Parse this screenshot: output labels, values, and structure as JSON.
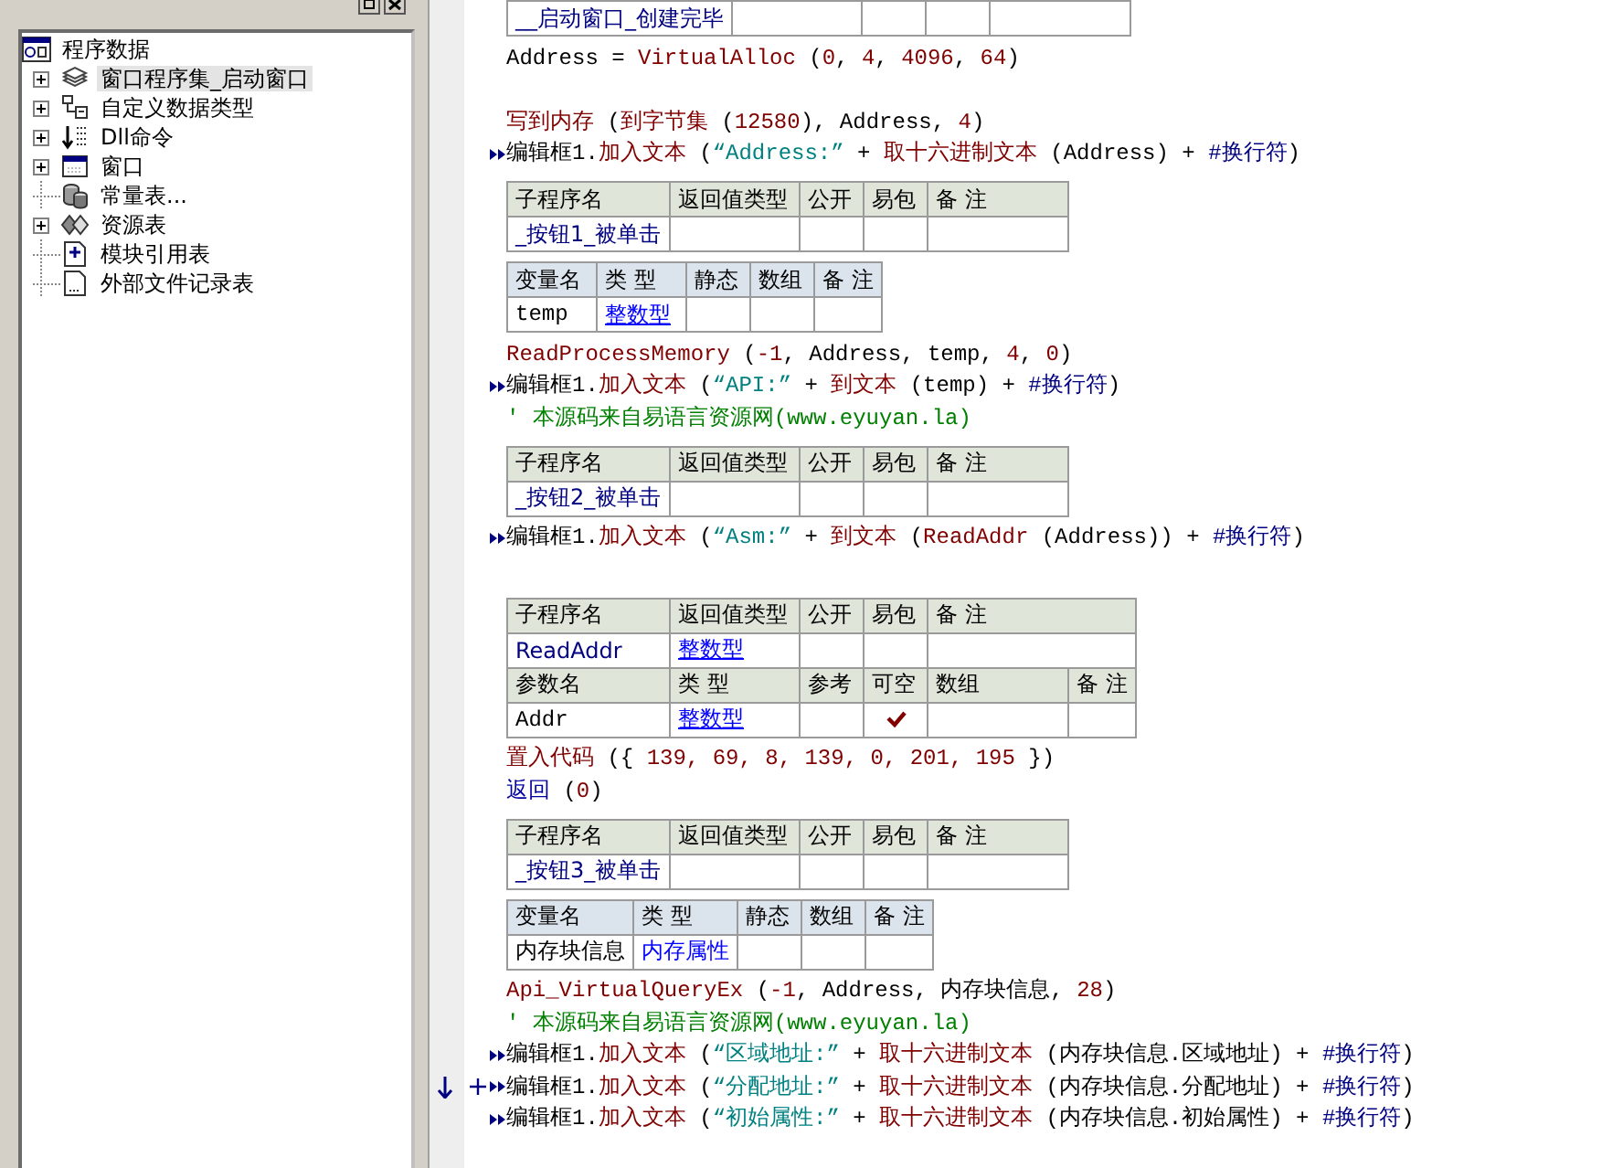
{
  "tree": {
    "root": {
      "label": "程序数据"
    },
    "items": [
      {
        "label": "窗口程序集_启动窗口",
        "kind": "pages",
        "expandable": true,
        "selected": true
      },
      {
        "label": "自定义数据类型",
        "kind": "types",
        "expandable": true,
        "selected": false
      },
      {
        "label": "Dll命令",
        "kind": "dll",
        "expandable": true,
        "selected": false
      },
      {
        "label": "窗口",
        "kind": "window",
        "expandable": true,
        "selected": false
      },
      {
        "label": "常量表...",
        "kind": "constants",
        "expandable": false,
        "selected": false
      },
      {
        "label": "资源表",
        "kind": "resources",
        "expandable": true,
        "selected": false
      },
      {
        "label": "模块引用表",
        "kind": "module",
        "expandable": false,
        "selected": false
      },
      {
        "label": "外部文件记录表",
        "kind": "file",
        "expandable": false,
        "selected": false
      }
    ]
  },
  "code": [
    {
      "kind": "sub_table",
      "rows": [
        {
          "header": false,
          "cells": [
            {
              "text": "__启动窗口_创建完毕",
              "kind": "name"
            },
            {},
            {},
            {},
            {}
          ]
        }
      ]
    },
    {
      "kind": "line",
      "arrow": false,
      "plus": false,
      "down": false,
      "tokens": [
        {
          "text": "Address = ",
          "kind": "plain"
        },
        {
          "text": "VirtualAlloc",
          "kind": "func"
        },
        {
          "text": " (",
          "kind": "plain"
        },
        {
          "text": "0",
          "kind": "num"
        },
        {
          "text": ", ",
          "kind": "plain"
        },
        {
          "text": "4",
          "kind": "num"
        },
        {
          "text": ", ",
          "kind": "plain"
        },
        {
          "text": "4096",
          "kind": "num"
        },
        {
          "text": ", ",
          "kind": "plain"
        },
        {
          "text": "64",
          "kind": "num"
        },
        {
          "text": ")",
          "kind": "plain"
        }
      ]
    },
    {
      "kind": "blank"
    },
    {
      "kind": "line",
      "arrow": false,
      "plus": false,
      "down": false,
      "tokens": [
        {
          "text": "写到内存",
          "kind": "func"
        },
        {
          "text": " (",
          "kind": "plain"
        },
        {
          "text": "到字节集",
          "kind": "func"
        },
        {
          "text": " (",
          "kind": "plain"
        },
        {
          "text": "12580",
          "kind": "num"
        },
        {
          "text": "), Address, ",
          "kind": "plain"
        },
        {
          "text": "4",
          "kind": "num"
        },
        {
          "text": ")",
          "kind": "plain"
        }
      ]
    },
    {
      "kind": "line",
      "arrow": true,
      "plus": false,
      "down": false,
      "tokens": [
        {
          "text": "编辑框1.",
          "kind": "plain"
        },
        {
          "text": "加入文本",
          "kind": "func"
        },
        {
          "text": " (",
          "kind": "plain"
        },
        {
          "text": "“Address:”",
          "kind": "str"
        },
        {
          "text": " + ",
          "kind": "plain"
        },
        {
          "text": "取十六进制文本",
          "kind": "func"
        },
        {
          "text": " (Address) + ",
          "kind": "plain"
        },
        {
          "text": "#换行符",
          "kind": "const"
        },
        {
          "text": ")",
          "kind": "plain"
        }
      ]
    },
    {
      "kind": "sub_table",
      "rows": [
        {
          "header": true,
          "cells": [
            {
              "text": "子程序名"
            },
            {
              "text": "返回值类型"
            },
            {
              "text": "公开"
            },
            {
              "text": "易包"
            },
            {
              "text": "备 注"
            }
          ]
        },
        {
          "header": false,
          "cells": [
            {
              "text": "_按钮1_被单击",
              "kind": "name"
            },
            {},
            {},
            {},
            {}
          ]
        }
      ]
    },
    {
      "kind": "var_table",
      "rows": [
        {
          "header": true,
          "cells": [
            {
              "text": "变量名"
            },
            {
              "text": "类 型"
            },
            {
              "text": "静态"
            },
            {
              "text": "数组"
            },
            {
              "text": "备 注"
            }
          ]
        },
        {
          "header": false,
          "cells": [
            {
              "text": "temp",
              "kind": "plain"
            },
            {
              "text": "整数型",
              "kind": "link"
            },
            {},
            {},
            {}
          ]
        }
      ]
    },
    {
      "kind": "line",
      "arrow": false,
      "plus": false,
      "down": false,
      "tokens": [
        {
          "text": "ReadProcessMemory",
          "kind": "func"
        },
        {
          "text": " (",
          "kind": "plain"
        },
        {
          "text": "-1",
          "kind": "num"
        },
        {
          "text": ", Address, temp, ",
          "kind": "plain"
        },
        {
          "text": "4",
          "kind": "num"
        },
        {
          "text": ", ",
          "kind": "plain"
        },
        {
          "text": "0",
          "kind": "num"
        },
        {
          "text": ")",
          "kind": "plain"
        }
      ]
    },
    {
      "kind": "line",
      "arrow": true,
      "plus": false,
      "down": false,
      "tokens": [
        {
          "text": "编辑框1.",
          "kind": "plain"
        },
        {
          "text": "加入文本",
          "kind": "func"
        },
        {
          "text": " (",
          "kind": "plain"
        },
        {
          "text": "“API:”",
          "kind": "str"
        },
        {
          "text": " + ",
          "kind": "plain"
        },
        {
          "text": "到文本",
          "kind": "func"
        },
        {
          "text": " (temp) + ",
          "kind": "plain"
        },
        {
          "text": "#换行符",
          "kind": "const"
        },
        {
          "text": ")",
          "kind": "plain"
        }
      ]
    },
    {
      "kind": "line",
      "arrow": false,
      "plus": false,
      "down": false,
      "tokens": [
        {
          "text": "' 本源码来自易语言资源网(www.eyuyan.la)",
          "kind": "comment"
        }
      ]
    },
    {
      "kind": "sub_table",
      "rows": [
        {
          "header": true,
          "cells": [
            {
              "text": "子程序名"
            },
            {
              "text": "返回值类型"
            },
            {
              "text": "公开"
            },
            {
              "text": "易包"
            },
            {
              "text": "备 注"
            }
          ]
        },
        {
          "header": false,
          "cells": [
            {
              "text": "_按钮2_被单击",
              "kind": "name"
            },
            {},
            {},
            {},
            {}
          ]
        }
      ]
    },
    {
      "kind": "line",
      "arrow": true,
      "plus": false,
      "down": false,
      "tokens": [
        {
          "text": "编辑框1.",
          "kind": "plain"
        },
        {
          "text": "加入文本",
          "kind": "func"
        },
        {
          "text": " (",
          "kind": "plain"
        },
        {
          "text": "“Asm:”",
          "kind": "str"
        },
        {
          "text": " + ",
          "kind": "plain"
        },
        {
          "text": "到文本",
          "kind": "func"
        },
        {
          "text": " (",
          "kind": "plain"
        },
        {
          "text": "ReadAddr",
          "kind": "func"
        },
        {
          "text": " (Address)) + ",
          "kind": "plain"
        },
        {
          "text": "#换行符",
          "kind": "const"
        },
        {
          "text": ")",
          "kind": "plain"
        }
      ]
    },
    {
      "kind": "blank"
    },
    {
      "kind": "sub_table",
      "rows": [
        {
          "header": true,
          "cells": [
            {
              "text": "子程序名"
            },
            {
              "text": "返回值类型"
            },
            {
              "text": "公开"
            },
            {
              "text": "易包"
            },
            {
              "text": "备 注",
              "colspan": 2
            }
          ]
        },
        {
          "header": false,
          "cells": [
            {
              "text": "ReadAddr",
              "kind": "name"
            },
            {
              "text": "整数型",
              "kind": "link"
            },
            {},
            {},
            {
              "colspan": 2
            }
          ]
        },
        {
          "header": true,
          "cells": [
            {
              "text": "参数名"
            },
            {
              "text": "类 型"
            },
            {
              "text": "参考"
            },
            {
              "text": "可空"
            },
            {
              "text": "数组"
            },
            {
              "text": "备 注"
            }
          ]
        },
        {
          "header": false,
          "cells": [
            {
              "text": "Addr",
              "kind": "plain"
            },
            {
              "text": "整数型",
              "kind": "link"
            },
            {},
            {
              "check": true
            },
            {},
            {}
          ]
        }
      ]
    },
    {
      "kind": "line",
      "arrow": false,
      "plus": false,
      "down": false,
      "tokens": [
        {
          "text": "置入代码",
          "kind": "func"
        },
        {
          "text": " ({ ",
          "kind": "plain"
        },
        {
          "text": "139, 69, 8, 139, 0, 201, 195",
          "kind": "num"
        },
        {
          "text": " })",
          "kind": "plain"
        }
      ]
    },
    {
      "kind": "line",
      "arrow": false,
      "plus": false,
      "down": false,
      "tokens": [
        {
          "text": "返回",
          "kind": "keyword"
        },
        {
          "text": " (",
          "kind": "plain"
        },
        {
          "text": "0",
          "kind": "num"
        },
        {
          "text": ")",
          "kind": "plain"
        }
      ]
    },
    {
      "kind": "sub_table",
      "rows": [
        {
          "header": true,
          "cells": [
            {
              "text": "子程序名"
            },
            {
              "text": "返回值类型"
            },
            {
              "text": "公开"
            },
            {
              "text": "易包"
            },
            {
              "text": "备 注"
            }
          ]
        },
        {
          "header": false,
          "cells": [
            {
              "text": "_按钮3_被单击",
              "kind": "name"
            },
            {},
            {},
            {},
            {}
          ]
        }
      ]
    },
    {
      "kind": "var_table",
      "rows": [
        {
          "header": true,
          "cells": [
            {
              "text": "变量名"
            },
            {
              "text": "类 型"
            },
            {
              "text": "静态"
            },
            {
              "text": "数组"
            },
            {
              "text": "备 注"
            }
          ]
        },
        {
          "header": false,
          "cells": [
            {
              "text": "内存块信息",
              "kind": "plain"
            },
            {
              "text": "内存属性",
              "kind": "type"
            },
            {},
            {},
            {}
          ]
        }
      ]
    },
    {
      "kind": "line",
      "arrow": false,
      "plus": false,
      "down": false,
      "tokens": [
        {
          "text": "Api_VirtualQueryEx",
          "kind": "func"
        },
        {
          "text": " (",
          "kind": "plain"
        },
        {
          "text": "-1",
          "kind": "num"
        },
        {
          "text": ", Address, 内存块信息, ",
          "kind": "plain"
        },
        {
          "text": "28",
          "kind": "num"
        },
        {
          "text": ")",
          "kind": "plain"
        }
      ]
    },
    {
      "kind": "line",
      "arrow": false,
      "plus": false,
      "down": false,
      "tokens": [
        {
          "text": "' 本源码来自易语言资源网(www.eyuyan.la)",
          "kind": "comment"
        }
      ]
    },
    {
      "kind": "line",
      "arrow": true,
      "plus": false,
      "down": false,
      "tokens": [
        {
          "text": "编辑框1.",
          "kind": "plain"
        },
        {
          "text": "加入文本",
          "kind": "func"
        },
        {
          "text": " (",
          "kind": "plain"
        },
        {
          "text": "“区域地址:”",
          "kind": "str"
        },
        {
          "text": " + ",
          "kind": "plain"
        },
        {
          "text": "取十六进制文本",
          "kind": "func"
        },
        {
          "text": " (内存块信息.区域地址) + ",
          "kind": "plain"
        },
        {
          "text": "#换行符",
          "kind": "const"
        },
        {
          "text": ")",
          "kind": "plain"
        }
      ]
    },
    {
      "kind": "line",
      "arrow": true,
      "plus": true,
      "down": true,
      "tokens": [
        {
          "text": "编辑框1.",
          "kind": "plain"
        },
        {
          "text": "加入文本",
          "kind": "func"
        },
        {
          "text": " (",
          "kind": "plain"
        },
        {
          "text": "“分配地址:”",
          "kind": "str"
        },
        {
          "text": " + ",
          "kind": "plain"
        },
        {
          "text": "取十六进制文本",
          "kind": "func"
        },
        {
          "text": " (内存块信息.分配地址) + ",
          "kind": "plain"
        },
        {
          "text": "#换行符",
          "kind": "const"
        },
        {
          "text": ")",
          "kind": "plain"
        }
      ]
    },
    {
      "kind": "line",
      "arrow": true,
      "plus": false,
      "down": false,
      "tokens": [
        {
          "text": "编辑框1.",
          "kind": "plain"
        },
        {
          "text": "加入文本",
          "kind": "func"
        },
        {
          "text": " (",
          "kind": "plain"
        },
        {
          "text": "“初始属性:”",
          "kind": "str"
        },
        {
          "text": " + ",
          "kind": "plain"
        },
        {
          "text": "取十六进制文本",
          "kind": "func"
        },
        {
          "text": " (内存块信息.初始属性) + ",
          "kind": "plain"
        },
        {
          "text": "#换行符",
          "kind": "const"
        },
        {
          "text": ")",
          "kind": "plain"
        }
      ]
    }
  ]
}
